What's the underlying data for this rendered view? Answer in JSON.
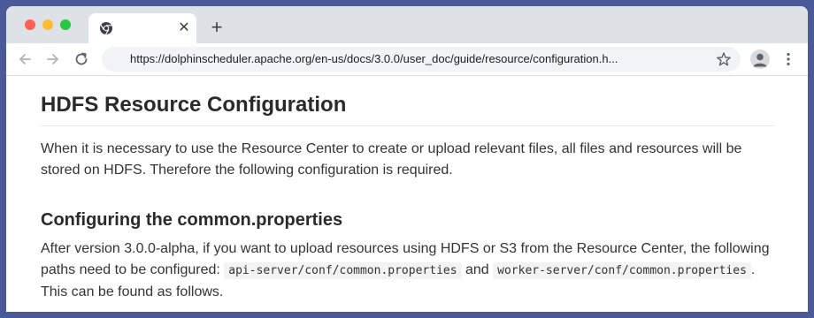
{
  "browser": {
    "url": "https://dolphinscheduler.apache.org/en-us/docs/3.0.0/user_doc/guide/resource/configuration.h...",
    "tab_close": "✕",
    "new_tab": "+"
  },
  "page": {
    "title": "HDFS Resource Configuration",
    "intro": "When it is necessary to use the Resource Center to create or upload relevant files, all files and resources will be stored on HDFS. Therefore the following configuration is required.",
    "section_heading": "Configuring the common.properties",
    "section_text_1": "After version 3.0.0-alpha, if you want to upload resources using HDFS or S3 from the Resource Center, the following paths need to be configured: ",
    "code_1": "api-server/conf/common.properties",
    "section_text_2": " and ",
    "code_2": "worker-server/conf/common.properties",
    "section_text_3": ". This can be found as follows."
  },
  "colors": {
    "background": "#4a5a98",
    "tabstrip": "#dee1e6",
    "text": "#333333"
  }
}
